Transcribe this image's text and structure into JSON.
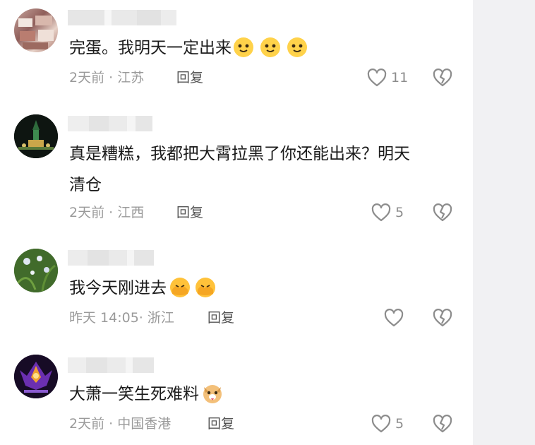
{
  "comments": [
    {
      "text": "完蛋。我明天一定出来",
      "time": "2天前",
      "sep": "·",
      "location": "江苏",
      "reply_label": "回复",
      "likes": "11",
      "emojis": [
        "smile-face-emoji",
        "smile-face-emoji",
        "smile-face-emoji"
      ]
    },
    {
      "text_line1": "真是糟糕，我都把大霄拉黑了你还能出来？明天",
      "text_line2": "清仓",
      "time": "2天前",
      "sep": "·",
      "location": "江西",
      "reply_label": "回复",
      "likes": "5"
    },
    {
      "text": "我今天刚进去",
      "time": "昨天 14:05",
      "sep": "·",
      "location": "浙江",
      "reply_label": "回复",
      "likes": "",
      "emojis": [
        "facepalm-emoji",
        "facepalm-emoji"
      ]
    },
    {
      "text": "大萧一笑生死难料",
      "time": "2天前",
      "sep": "·",
      "location": "中国香港",
      "reply_label": "回复",
      "likes": "5",
      "emojis": [
        "dog-face-emoji"
      ]
    }
  ],
  "colors": {
    "text": "#1b1b1b",
    "meta": "#9a9a9a",
    "reply": "#555555",
    "icon": "#8c8c8c",
    "side_panel": "#f1f1f3"
  }
}
